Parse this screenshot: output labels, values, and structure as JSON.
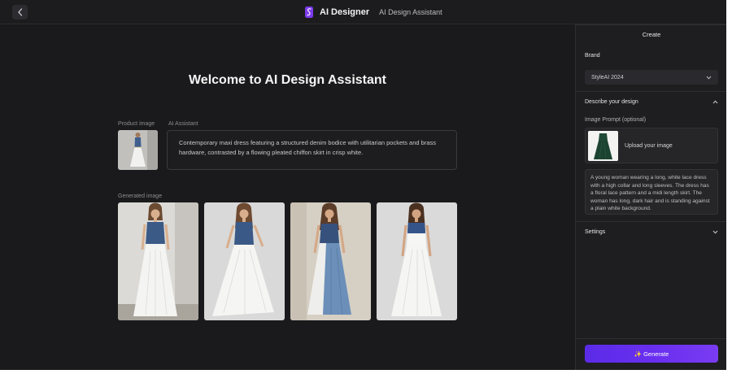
{
  "header": {
    "app_name": "AI Designer",
    "subtitle": "AI Design Assistant",
    "back_icon": "chevron-left-icon",
    "logo_color": "#7c3aed"
  },
  "main": {
    "welcome_title": "Welcome to AI Design Assistant",
    "product_image_label": "Product image",
    "assistant_label": "AI Assistant",
    "assistant_text": "Contemporary maxi dress featuring a structured denim bodice with utilitarian pockets and brass hardware, contrasted by a flowing pleated chiffon skirt in crisp white.",
    "generated_label": "Generated image"
  },
  "panel": {
    "title": "Create",
    "brand_label": "Brand",
    "brand_value": "StyleAI 2024",
    "describe_label": "Describe your design",
    "image_prompt_label": "Image Prompt (optional)",
    "upload_label": "Upload your image",
    "prompt_text": "A young woman wearing a long, white lace dress with a high collar and long sleeves. The dress has a floral lace pattern and a midi length skirt. The woman has long, dark hair and is standing against a plain white background.",
    "settings_label": "Settings",
    "generate_label": "✨ Generate"
  },
  "colors": {
    "accent": "#5b2be8",
    "background": "#1a1a1c",
    "panel": "#1e1e21"
  }
}
